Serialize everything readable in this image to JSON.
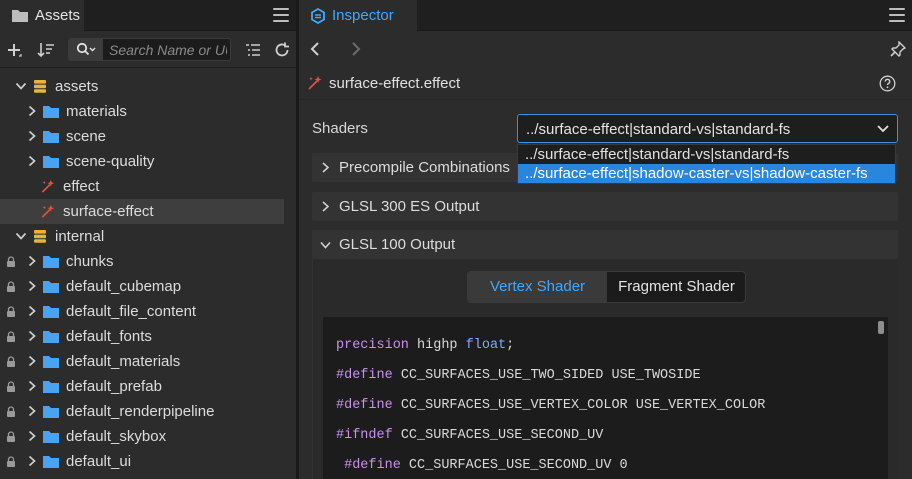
{
  "assets": {
    "tab_label": "Assets",
    "search_placeholder": "Search Name or UUID",
    "tree": [
      {
        "label": "assets",
        "kind": "db",
        "level": 0,
        "expanded": true,
        "locked": false
      },
      {
        "label": "materials",
        "kind": "folder",
        "level": 1,
        "expanded": false,
        "locked": false
      },
      {
        "label": "scene",
        "kind": "folder",
        "level": 1,
        "expanded": false,
        "locked": false
      },
      {
        "label": "scene-quality",
        "kind": "folder",
        "level": 1,
        "expanded": false,
        "locked": false
      },
      {
        "label": "effect",
        "kind": "effect",
        "level": 1,
        "locked": false
      },
      {
        "label": "surface-effect",
        "kind": "effect",
        "level": 1,
        "locked": false,
        "selected": true
      },
      {
        "label": "internal",
        "kind": "db",
        "level": 0,
        "expanded": true,
        "locked": false
      },
      {
        "label": "chunks",
        "kind": "folder",
        "level": 1,
        "expanded": false,
        "locked": true
      },
      {
        "label": "default_cubemap",
        "kind": "folder",
        "level": 1,
        "expanded": false,
        "locked": true
      },
      {
        "label": "default_file_content",
        "kind": "folder",
        "level": 1,
        "expanded": false,
        "locked": true
      },
      {
        "label": "default_fonts",
        "kind": "folder",
        "level": 1,
        "expanded": false,
        "locked": true
      },
      {
        "label": "default_materials",
        "kind": "folder",
        "level": 1,
        "expanded": false,
        "locked": true
      },
      {
        "label": "default_prefab",
        "kind": "folder",
        "level": 1,
        "expanded": false,
        "locked": true
      },
      {
        "label": "default_renderpipeline",
        "kind": "folder",
        "level": 1,
        "expanded": false,
        "locked": true
      },
      {
        "label": "default_skybox",
        "kind": "folder",
        "level": 1,
        "expanded": false,
        "locked": true
      },
      {
        "label": "default_ui",
        "kind": "folder",
        "level": 1,
        "expanded": false,
        "locked": true
      }
    ]
  },
  "inspector": {
    "tab_label": "Inspector",
    "file_name": "surface-effect.effect",
    "shaders_label": "Shaders",
    "shader_selected": "../surface-effect|standard-vs|standard-fs",
    "shader_options": [
      "../surface-effect|standard-vs|standard-fs",
      "../surface-effect|shadow-caster-vs|shadow-caster-fs"
    ],
    "sections": {
      "precompile": "Precompile Combinations",
      "glsl300": "GLSL 300 ES Output",
      "glsl100": "GLSL 100 Output"
    },
    "shader_tabs": {
      "vertex": "Vertex Shader",
      "fragment": "Fragment Shader"
    },
    "code": {
      "line1": {
        "pre": "precision",
        "mid": " highp ",
        "post": "float",
        "end": ";"
      },
      "line2": {
        "pre": "#define",
        "rest": " CC_SURFACES_USE_TWO_SIDED USE_TWOSIDE"
      },
      "line3": {
        "pre": "#define",
        "rest": " CC_SURFACES_USE_VERTEX_COLOR USE_VERTEX_COLOR"
      },
      "line4": {
        "pre": "#ifndef",
        "rest": " CC_SURFACES_USE_SECOND_UV"
      },
      "line5": {
        "pre": " #define",
        "rest": " CC_SURFACES_USE_SECOND_UV 0"
      }
    }
  },
  "colors": {
    "accent": "#3fa8ff",
    "selection": "#2a86dc",
    "folder": "#4aa3f0",
    "db_icon": "#e8b339",
    "effect_icon": "#e0533f",
    "keyword": "#c792ea",
    "type": "#82aaff"
  }
}
